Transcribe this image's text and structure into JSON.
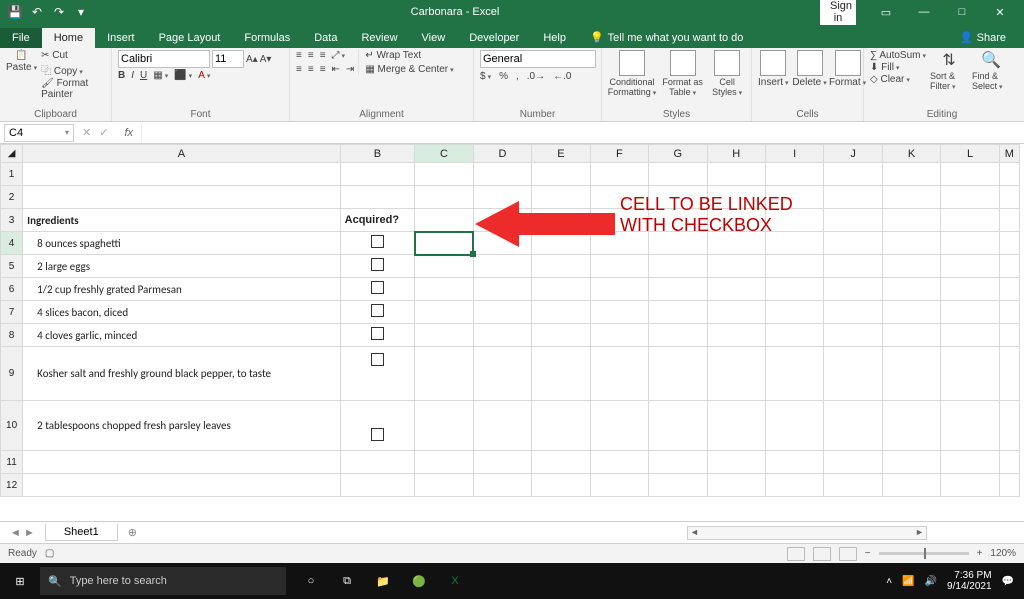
{
  "titlebar": {
    "title": "Carbonara - Excel",
    "signin": "Sign in"
  },
  "tabs": {
    "file": "File",
    "home": "Home",
    "insert": "Insert",
    "pagelayout": "Page Layout",
    "formulas": "Formulas",
    "data": "Data",
    "review": "Review",
    "view": "View",
    "developer": "Developer",
    "help": "Help",
    "tellme": "Tell me what you want to do",
    "share": "Share"
  },
  "ribbon": {
    "clipboard": {
      "label": "Clipboard",
      "paste": "Paste",
      "cut": "Cut",
      "copy": "Copy",
      "painter": "Format Painter"
    },
    "font": {
      "label": "Font",
      "name": "Calibri",
      "size": "11"
    },
    "alignment": {
      "label": "Alignment",
      "wrap": "Wrap Text",
      "merge": "Merge & Center"
    },
    "number": {
      "label": "Number",
      "format": "General"
    },
    "styles": {
      "label": "Styles",
      "cond": "Conditional Formatting",
      "tbl": "Format as Table",
      "cell": "Cell Styles"
    },
    "cells": {
      "label": "Cells",
      "insert": "Insert",
      "delete": "Delete",
      "format": "Format"
    },
    "editing": {
      "label": "Editing",
      "autosum": "AutoSum",
      "fill": "Fill",
      "clear": "Clear",
      "sort": "Sort & Filter",
      "find": "Find & Select"
    }
  },
  "fbar": {
    "cellref": "C4",
    "fx": "fx",
    "formula": ""
  },
  "columns": [
    "A",
    "B",
    "C",
    "D",
    "E",
    "F",
    "G",
    "H",
    "I",
    "J",
    "K",
    "L",
    "M"
  ],
  "rows": {
    "header_ing": "Ingredients",
    "header_acq": "Acquired?",
    "items": [
      "8 ounces spaghetti",
      "2 large eggs",
      "1/2 cup freshly grated Parmesan",
      "4 slices bacon, diced",
      "4 cloves garlic, minced",
      "Kosher salt and freshly ground black pepper, to taste",
      "2 tablespoons chopped fresh parsley leaves"
    ]
  },
  "annotation": {
    "line1": "CELL TO BE LINKED",
    "line2": "WITH CHECKBOX"
  },
  "sheets": {
    "name": "Sheet1"
  },
  "status": {
    "ready": "Ready",
    "zoom": "120%"
  },
  "taskbar": {
    "search": "Type here to search",
    "time": "7:36 PM",
    "date": "9/14/2021"
  }
}
